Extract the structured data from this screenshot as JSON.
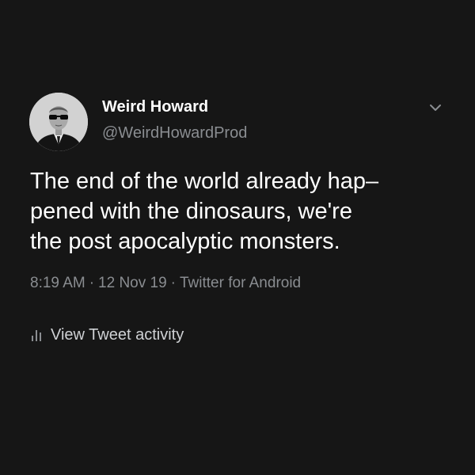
{
  "user": {
    "display_name": "Weird Howard",
    "handle": "@WeirdHowardProd"
  },
  "tweet": {
    "lines": [
      "The end of the world already hap–",
      "pened with the dinosaurs, we're",
      "the post apocalyptic monsters."
    ],
    "time": "8:19 AM",
    "date": "12 Nov 19",
    "source": "Twitter for Android",
    "separator": "·"
  },
  "actions": {
    "view_activity_label": "View Tweet activity"
  },
  "icons": {
    "menu": "chevron-down-icon",
    "activity": "bar-chart-icon"
  },
  "colors": {
    "background": "#161616",
    "primary_text": "#ffffff",
    "secondary_text": "#8a8d91"
  }
}
